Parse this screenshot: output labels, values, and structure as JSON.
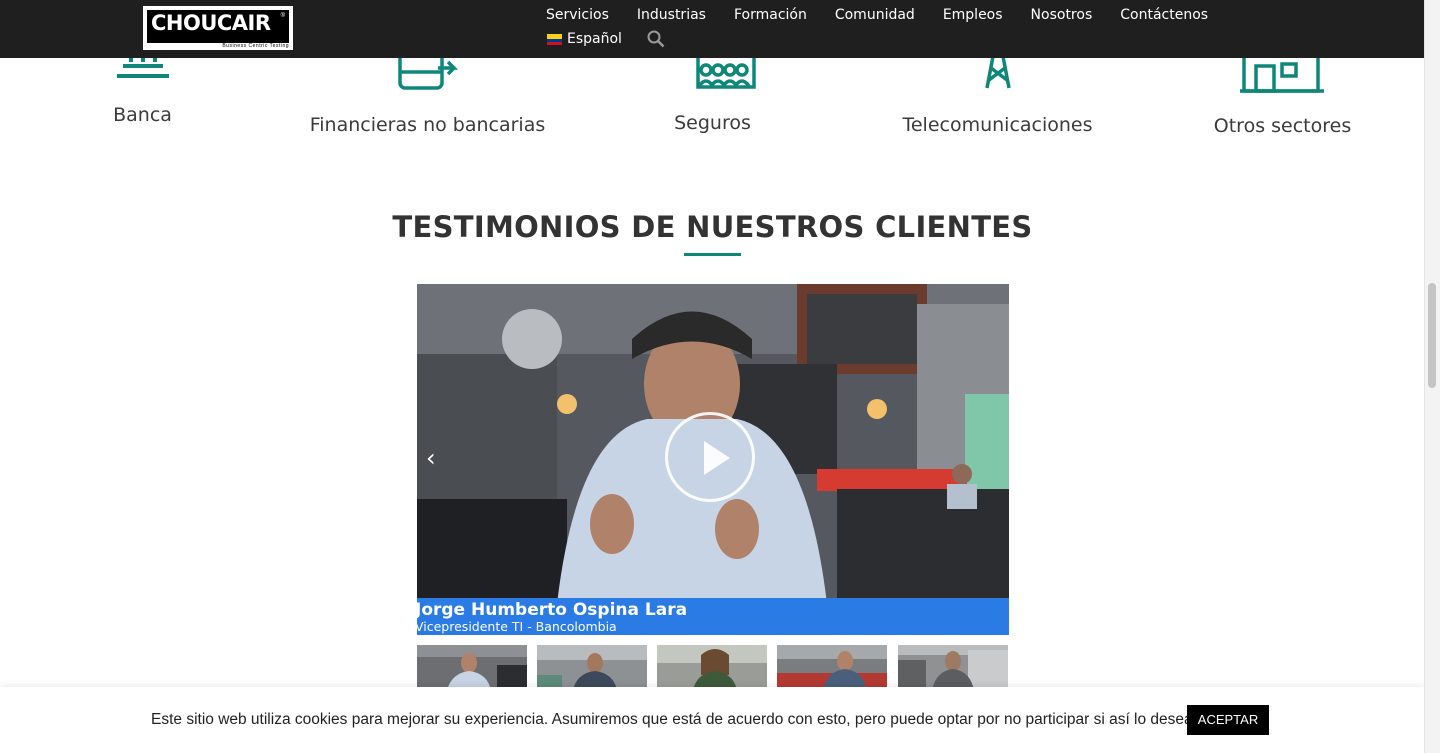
{
  "header": {
    "logo_text": "CHOUCAIR",
    "logo_tagline": "Business Centric Testing",
    "nav": [
      "Servicios",
      "Industrias",
      "Formación",
      "Comunidad",
      "Empleos",
      "Nosotros",
      "Contáctenos"
    ],
    "language": "Español"
  },
  "industries": [
    {
      "label": "Banca",
      "icon": "bank-icon"
    },
    {
      "label": "Financieras no bancarias",
      "icon": "mobile-money-icon"
    },
    {
      "label": "Seguros",
      "icon": "insurance-building-icon"
    },
    {
      "label": "Telecomunicaciones",
      "icon": "antenna-tower-icon"
    },
    {
      "label": "Otros sectores",
      "icon": "factory-icon"
    }
  ],
  "testimonials": {
    "title": "TESTIMONIOS DE NUESTROS CLIENTES",
    "video": {
      "person_name": "Jorge Humberto Ospina Lara",
      "person_role": "Vicepresidente TI - Bancolombia"
    },
    "thumbnail_count": 5
  },
  "cookie_bar": {
    "message": "Este sitio web utiliza cookies para mejorar su experiencia. Asumiremos que está de acuerdo con esto, pero puede optar por no participar si así lo desea.",
    "accept_label": "ACEPTAR"
  },
  "colors": {
    "accent": "#0e8778",
    "header_bg": "#1f1f1f",
    "lower_third": "#2a7be4"
  }
}
